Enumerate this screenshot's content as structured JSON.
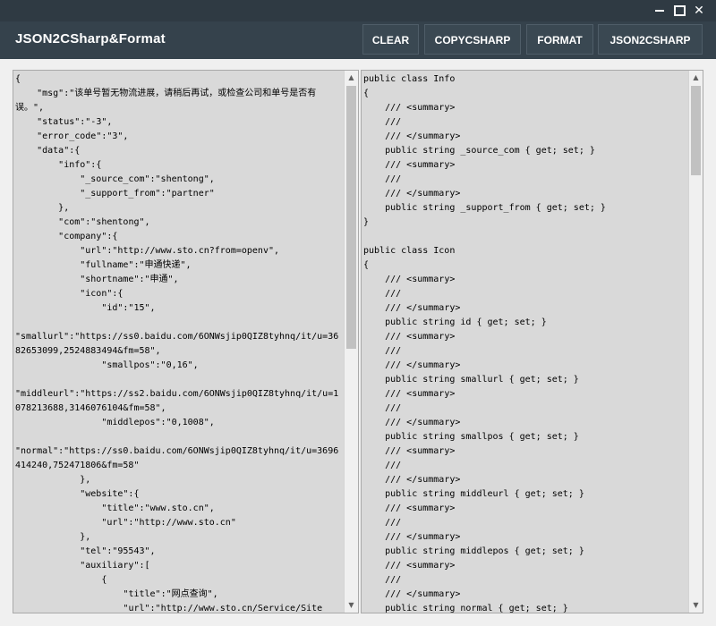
{
  "app": {
    "title": "JSON2CSharp&Format"
  },
  "window_controls": {
    "minimize_icon": "minimize-icon",
    "maximize_icon": "maximize-icon",
    "close_icon": "close-icon",
    "close_glyph": "✕"
  },
  "toolbar": {
    "clear_label": "CLEAR",
    "copy_label": "COPYCSHARP",
    "format_label": "FORMAT",
    "json2csharp_label": "JSON2CSHARP"
  },
  "json_editor": {
    "text": "{\n    \"msg\":\"该单号暂无物流进展，请稍后再试，或检查公司和单号是否有误。\",\n    \"status\":\"-3\",\n    \"error_code\":\"3\",\n    \"data\":{\n        \"info\":{\n            \"_source_com\":\"shentong\",\n            \"_support_from\":\"partner\"\n        },\n        \"com\":\"shentong\",\n        \"company\":{\n            \"url\":\"http://www.sto.cn?from=openv\",\n            \"fullname\":\"申通快递\",\n            \"shortname\":\"申通\",\n            \"icon\":{\n                \"id\":\"15\",\n\n\"smallurl\":\"https://ss0.baidu.com/6ONWsjip0QIZ8tyhnq/it/u=3682653099,2524883494&fm=58\",\n                \"smallpos\":\"0,16\",\n\n\"middleurl\":\"https://ss2.baidu.com/6ONWsjip0QIZ8tyhnq/it/u=1078213688,3146076104&fm=58\",\n                \"middlepos\":\"0,1008\",\n\n\"normal\":\"https://ss0.baidu.com/6ONWsjip0QIZ8tyhnq/it/u=3696414240,752471806&fm=58\"\n            },\n            \"website\":{\n                \"title\":\"www.sto.cn\",\n                \"url\":\"http://www.sto.cn\"\n            },\n            \"tel\":\"95543\",\n            \"auxiliary\":[\n                {\n                    \"title\":\"网点查询\",\n                    \"url\":\"http://www.sto.cn/Service/Site"
  },
  "csharp_output": {
    "text": "public class Info\n{\n    /// <summary>\n    ///\n    /// </summary>\n    public string _source_com { get; set; }\n    /// <summary>\n    ///\n    /// </summary>\n    public string _support_from { get; set; }\n}\n\npublic class Icon\n{\n    /// <summary>\n    ///\n    /// </summary>\n    public string id { get; set; }\n    /// <summary>\n    ///\n    /// </summary>\n    public string smallurl { get; set; }\n    /// <summary>\n    ///\n    /// </summary>\n    public string smallpos { get; set; }\n    /// <summary>\n    ///\n    /// </summary>\n    public string middleurl { get; set; }\n    /// <summary>\n    ///\n    /// </summary>\n    public string middlepos { get; set; }\n    /// <summary>\n    ///\n    /// </summary>\n    public string normal { get; set; }"
  },
  "scroll": {
    "up_icon": "scroll-up-arrow-icon",
    "down_icon": "scroll-down-arrow-icon",
    "up_glyph": "▲",
    "down_glyph": "▼"
  },
  "colors": {
    "title_bar": "#2f3a43",
    "header": "#35424c",
    "editor_bg": "#d9d9d9",
    "content_bg": "#f0f0f0"
  }
}
